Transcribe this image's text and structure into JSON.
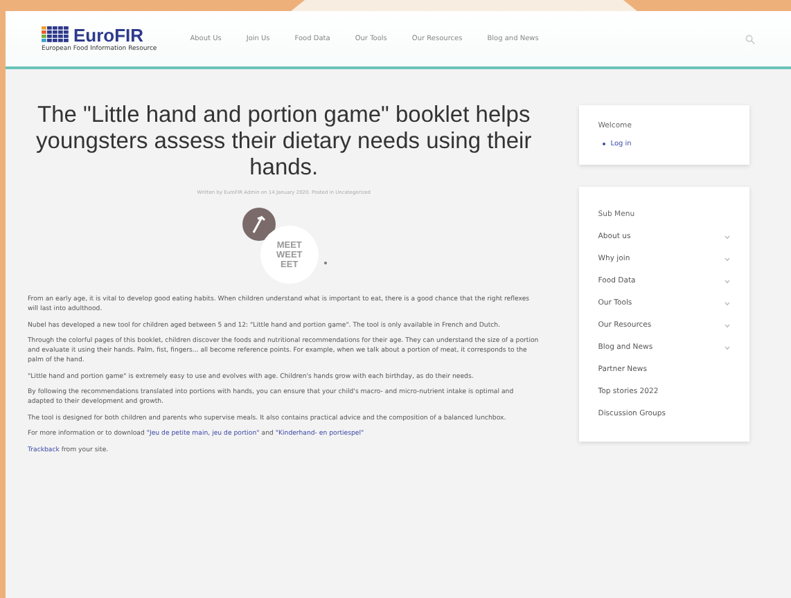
{
  "header": {
    "logo": {
      "name": "EuroFIR",
      "tagline": "European Food Information Resource"
    },
    "nav": [
      "About Us",
      "Join Us",
      "Food Data",
      "Our Tools",
      "Our Resources",
      "Blog and News"
    ]
  },
  "article": {
    "title": "The \"Little hand and portion game\" booklet helps youngsters assess their dietary needs using their hands.",
    "byline": "Written by EuroFIR Admin on 14 January 2020. Posted in Uncategorized",
    "image": {
      "logo_lines": [
        "MEET",
        "WEET",
        "EET"
      ]
    },
    "paragraphs": [
      {
        "text": "From an early age, it is vital to develop good eating habits. When children understand what is important to eat, there is a good chance that the right reflexes will last into adulthood."
      },
      {
        "text": "Nubel has developed a new tool for children aged between 5 and 12: \"Little hand and portion game\". The tool is only available in French and Dutch."
      },
      {
        "text": "Through the colorful pages of this booklet, children discover the foods and nutritional recommendations for their age. They can understand the size of a portion and evaluate it using their hands. Palm, fist, fingers... all become reference points. For example, when we talk about a portion of meat, it corresponds to the palm of the hand."
      },
      {
        "text": "\"Little hand and portion game\" is extremely easy to use and evolves with age. Children's hands grow with each birthday, as do their needs."
      },
      {
        "text": "By following the recommendations translated into portions with hands, you can ensure that your child's macro- and micro-nutrient intake is optimal and adapted to their development and growth."
      },
      {
        "text": "The tool is designed for both children and parents who supervise meals. It also contains practical advice and the composition of a balanced lunchbox."
      }
    ],
    "download": {
      "intro": "For more information or to download",
      "link_1": "\"Jeu de petite main, jeu de portion\"",
      "between": "and",
      "link_2": "\"Kinderhand- en portiespel\""
    },
    "trackback": {
      "link": "Trackback",
      "rest": "from your site."
    }
  },
  "sidebar": {
    "welcome": {
      "title": "Welcome",
      "link": "Log in"
    },
    "submenu": {
      "title": "Sub Menu",
      "items": [
        {
          "label": "About us",
          "expandable": true
        },
        {
          "label": "Why join",
          "expandable": true
        },
        {
          "label": "Food Data",
          "expandable": true
        },
        {
          "label": "Our Tools",
          "expandable": true
        },
        {
          "label": "Our Resources",
          "expandable": true
        },
        {
          "label": "Blog and News",
          "expandable": true
        },
        {
          "label": "Partner News",
          "expandable": false
        },
        {
          "label": "Top stories 2022",
          "expandable": false
        },
        {
          "label": "Discussion Groups",
          "expandable": false
        }
      ]
    }
  }
}
